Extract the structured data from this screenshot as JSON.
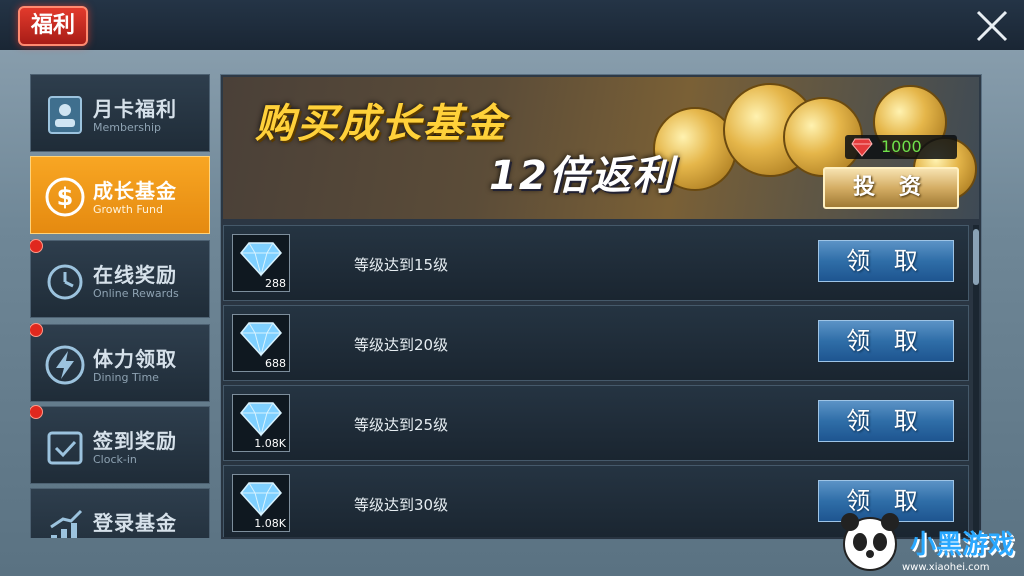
{
  "header": {
    "title": "福利"
  },
  "sidebar": {
    "items": [
      {
        "cn": "月卡福利",
        "en": "Membership",
        "icon": "membership-card-icon",
        "active": false,
        "dot": false
      },
      {
        "cn": "成长基金",
        "en": "Growth Fund",
        "icon": "dollar-coin-icon",
        "active": true,
        "dot": false
      },
      {
        "cn": "在线奖励",
        "en": "Online Rewards",
        "icon": "clock-icon",
        "active": false,
        "dot": true
      },
      {
        "cn": "体力领取",
        "en": "Dining Time",
        "icon": "lightning-icon",
        "active": false,
        "dot": true
      },
      {
        "cn": "签到奖励",
        "en": "Clock-in",
        "icon": "checkmark-calendar-icon",
        "active": false,
        "dot": true
      },
      {
        "cn": "登录基金",
        "en": "",
        "icon": "chart-up-icon",
        "active": false,
        "dot": false
      }
    ]
  },
  "banner": {
    "title": "购买成长基金",
    "subtitle": "12倍返利",
    "cost": "1000",
    "invest_label": "投 资"
  },
  "rewards": [
    {
      "text": "等级达到15级",
      "count": "288",
      "button": "领 取"
    },
    {
      "text": "等级达到20级",
      "count": "688",
      "button": "领 取"
    },
    {
      "text": "等级达到25级",
      "count": "1.08K",
      "button": "领 取"
    },
    {
      "text": "等级达到30级",
      "count": "1.08K",
      "button": "领 取"
    }
  ],
  "watermark": {
    "text": "小黑游戏",
    "url": "www.xiaohei.com"
  },
  "colors": {
    "accent": "#f8a623",
    "claim_blue": "#2f6ea8",
    "gem_green": "#6fe04a",
    "header_red": "#e23a2c"
  }
}
